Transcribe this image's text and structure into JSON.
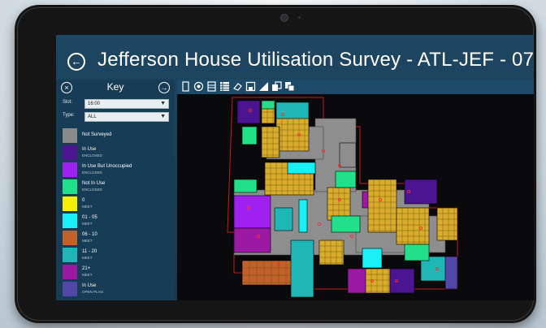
{
  "app": {
    "title": "Jefferson House Utilisation Survey - ATL-JEF - 07"
  },
  "key_panel": {
    "title": "Key",
    "fields": [
      {
        "label": "Slot:",
        "value": "16:00"
      },
      {
        "label": "Type:",
        "value": "ALL"
      }
    ],
    "legend": [
      {
        "label": "Not Surveyed",
        "sub": "",
        "color": "#8a8a8a"
      },
      {
        "label": "In Use",
        "sub": "ENCLOSED",
        "color": "#4b1490"
      },
      {
        "label": "In Use But Unoccupied",
        "sub": "ENCLOSED",
        "color": "#a020f0"
      },
      {
        "label": "Not In Use",
        "sub": "ENCLOSED",
        "color": "#22e08a"
      },
      {
        "label": "0",
        "sub": "MEET",
        "color": "#f5f000"
      },
      {
        "label": "01 - 05",
        "sub": "MEET",
        "color": "#19f0f5"
      },
      {
        "label": "06 - 10",
        "sub": "MEET",
        "color": "#c2622a"
      },
      {
        "label": "11 - 20",
        "sub": "MEET",
        "color": "#1eb7b5"
      },
      {
        "label": "21+",
        "sub": "MEET",
        "color": "#9c1aa3"
      },
      {
        "label": "In Use",
        "sub": "OPEN PLAN",
        "color": "#5147a8"
      }
    ]
  },
  "toolbar": {
    "tools": [
      "page-icon",
      "target-icon",
      "list-icon",
      "table-icon",
      "eraser-icon",
      "save-icon",
      "triangle-icon",
      "copy-icon",
      "paste-icon"
    ]
  },
  "floor_plan": {
    "room_colors": {
      "corridor": "#8e8e8e",
      "desk_area": "#d9ac2c",
      "not_in_use": "#22e08a",
      "in_use": "#4b1490",
      "meet_small": "#19f0f5",
      "meet_mid": "#1eb7b5",
      "meet_large": "#9c1aa3",
      "meet_orange": "#c2622a",
      "unoccupied": "#a020f0",
      "open_plan": "#5147a8"
    }
  }
}
